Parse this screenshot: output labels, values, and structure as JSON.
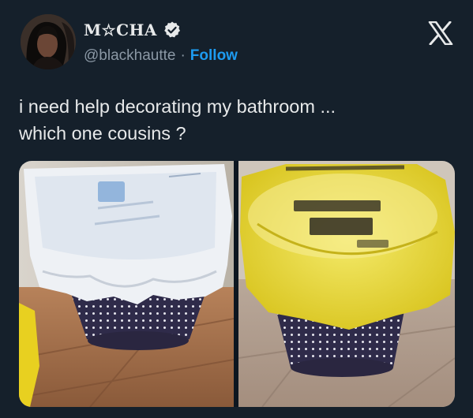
{
  "author": {
    "display_name": "M☆CHA",
    "handle": "@blackhautte",
    "separator": "·",
    "follow_label": "Follow",
    "verified_icon": "verified-badge-icon"
  },
  "brand_icon": "x-logo-icon",
  "tweet": {
    "text_line1": "i need help decorating my bathroom ...",
    "text_line2": "which one cousins ?"
  },
  "colors": {
    "background": "#15202b",
    "text": "#e7e9ea",
    "secondary_text": "#8b98a5",
    "link": "#1d9bf0"
  },
  "media": {
    "count": 2
  }
}
